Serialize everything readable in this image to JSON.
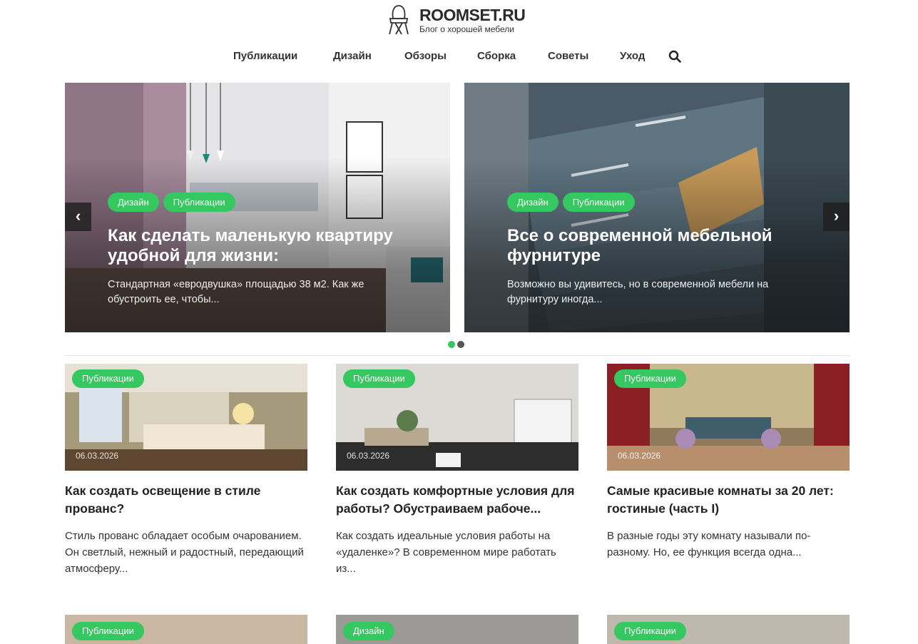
{
  "header": {
    "logo_title": "ROOMSET.RU",
    "logo_subtitle": "Блог о хорошей мебели",
    "logo_icon": "chair-icon"
  },
  "nav": {
    "items": [
      "Публикации",
      "Дизайн",
      "Обзоры",
      "Сборка",
      "Советы",
      "Уход"
    ],
    "search_icon": "search-icon"
  },
  "slider": {
    "prev_label": "‹",
    "next_label": "›",
    "slides": [
      {
        "tags": [
          "Дизайн",
          "Публикации"
        ],
        "title": "Как сделать маленькую квартиру удобной для жизни:",
        "excerpt": "Стандартная «евродвушка» площадью 38 м2. Как же обустроить ее, чтобы..."
      },
      {
        "tags": [
          "Дизайн",
          "Публикации"
        ],
        "title": "Все о современной мебельной фурнитуре",
        "excerpt": "Возможно вы удивитесь, но в современной мебели на фурнитуру иногда..."
      }
    ],
    "active_dot": 0
  },
  "posts": [
    {
      "tag": "Публикации",
      "date": "06.03.2026",
      "title": "Как создать освещение в стиле прованс?",
      "excerpt": "Стиль прованс обладает особым очарованием. Он светлый, нежный и радостный, передающий атмосферу..."
    },
    {
      "tag": "Публикации",
      "date": "06.03.2026",
      "title": "Как создать комфортные условия для работы? Обустраиваем рабоче...",
      "excerpt": "Как создать идеальные условия работы на «удаленке»? В современном мире работать из..."
    },
    {
      "tag": "Публикации",
      "date": "06.03.2026",
      "title": "Самые красивые комнаты за 20 лет: гостиные (часть I)",
      "excerpt": "В разные годы эту комнату называли по-разному. Но, ее функция всегда одна..."
    }
  ],
  "more_posts": [
    {
      "tag": "Публикации"
    },
    {
      "tag": "Дизайн"
    },
    {
      "tag": "Публикации"
    }
  ],
  "colors": {
    "accent": "#35c760",
    "text": "#222222"
  }
}
